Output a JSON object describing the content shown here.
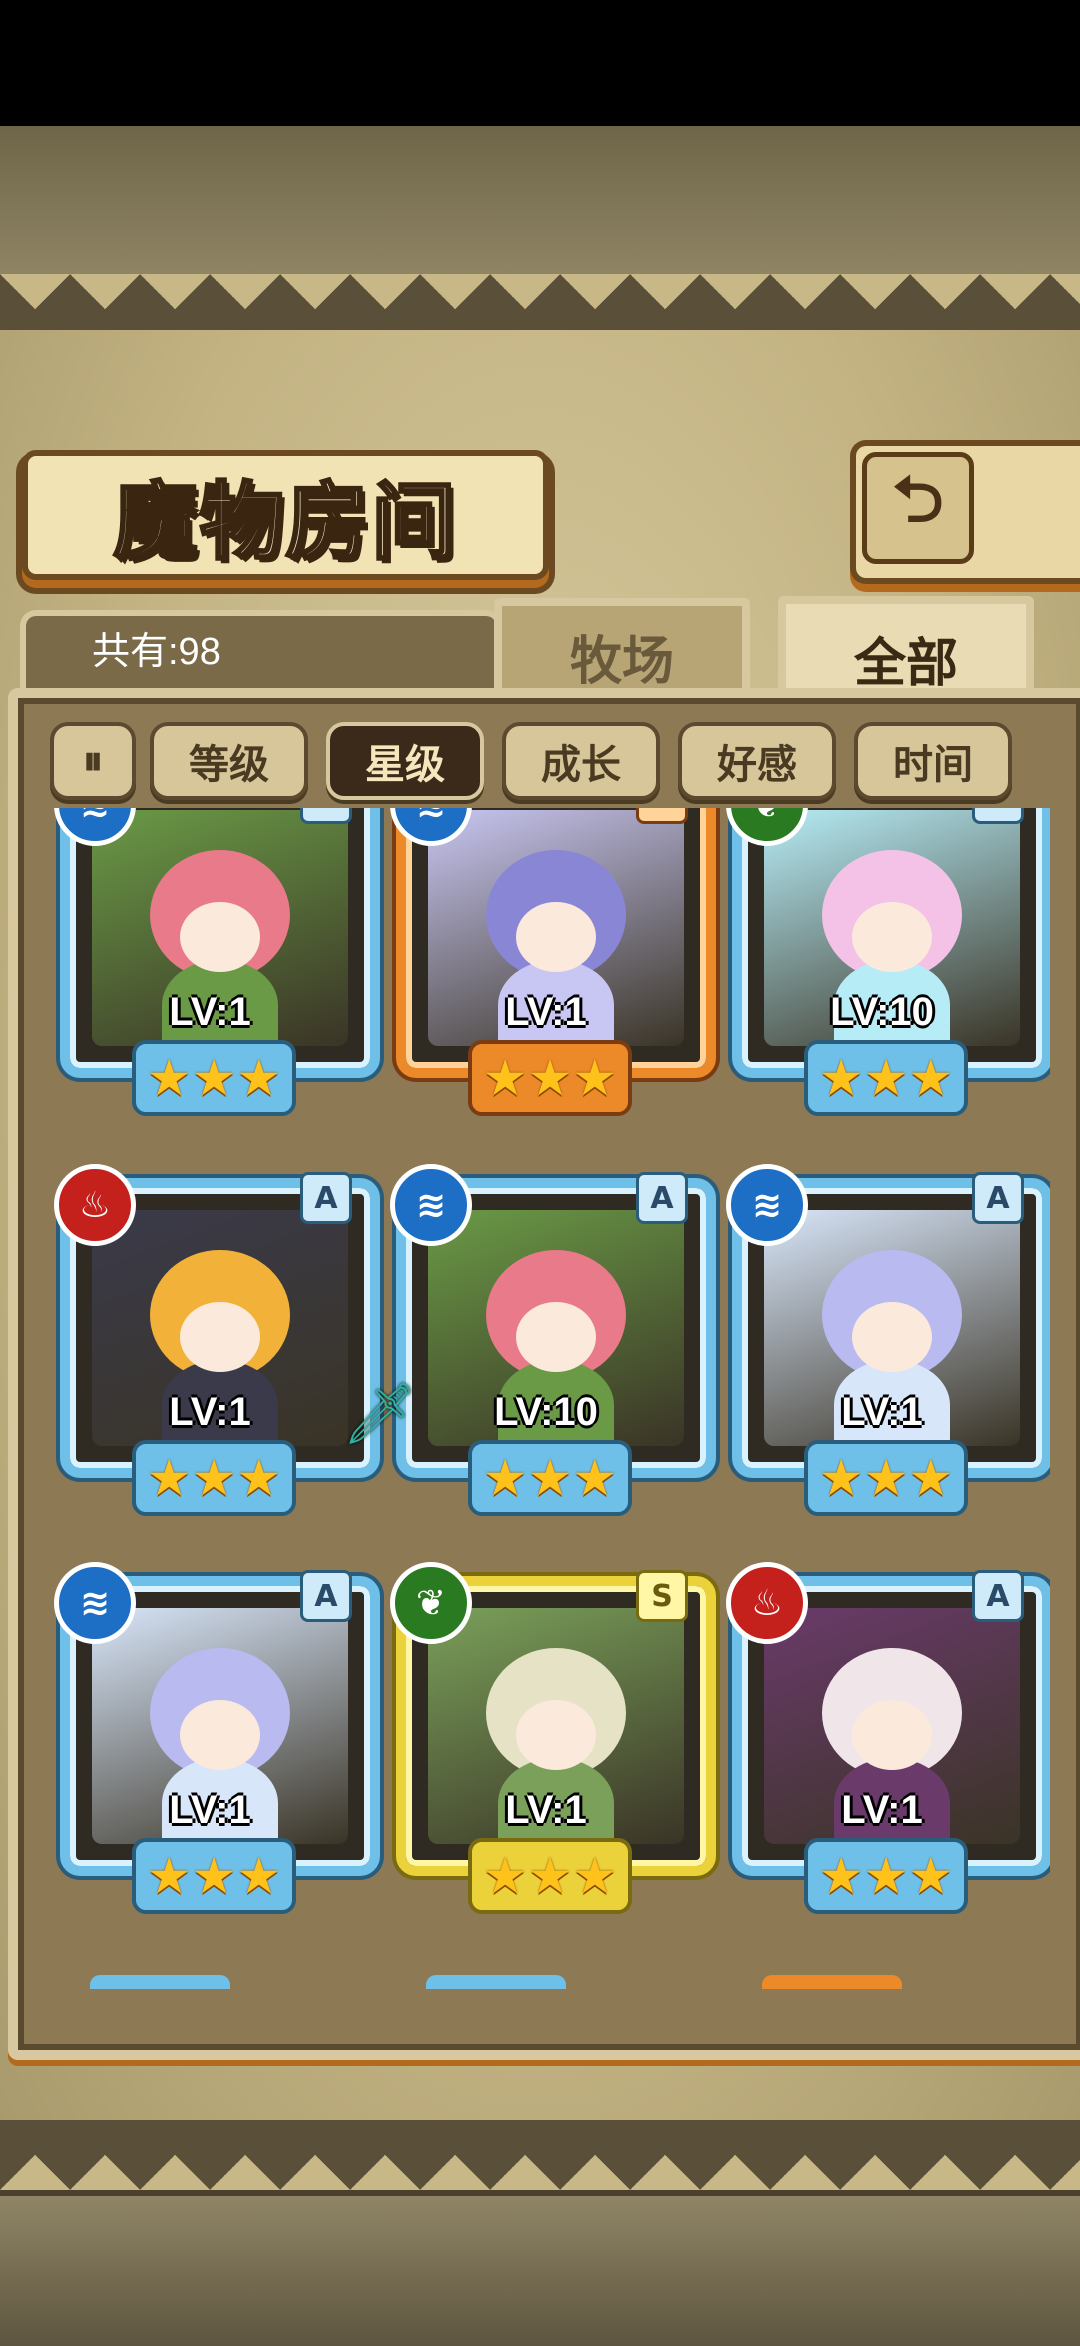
{
  "header": {
    "title": "魔物房间",
    "back_icon": "back-arrow-icon"
  },
  "info": {
    "count_text": "共有:98"
  },
  "tabs": [
    {
      "label": "牧场",
      "active": false
    },
    {
      "label": "全部",
      "active": true
    }
  ],
  "sort": {
    "pause_symbol": "⏸",
    "buttons": [
      {
        "label": "等级",
        "active": false
      },
      {
        "label": "星级",
        "active": true
      },
      {
        "label": "成长",
        "active": false
      },
      {
        "label": "好感",
        "active": false
      },
      {
        "label": "时间",
        "active": false
      }
    ]
  },
  "elements": {
    "water": {
      "icon": "water-icon",
      "glyph": "≋",
      "color": "#1c6fc4"
    },
    "fire": {
      "icon": "fire-icon",
      "glyph": "♨",
      "color": "#c4201c"
    },
    "wood": {
      "icon": "leaf-icon",
      "glyph": "❦",
      "color": "#2a7a22"
    }
  },
  "monsters": [
    {
      "element": "water",
      "rank": "A",
      "level": "LV:1",
      "stars": 3,
      "palette": [
        "#e87a8a",
        "#6a9a46"
      ],
      "equipped": false
    },
    {
      "element": "water",
      "rank": "B",
      "level": "LV:1",
      "stars": 3,
      "palette": [
        "#8a86d6",
        "#c8c6f2"
      ],
      "equipped": false
    },
    {
      "element": "wood",
      "rank": "A",
      "level": "LV:10",
      "stars": 3,
      "palette": [
        "#f4c2e6",
        "#b6ecf6"
      ],
      "equipped": false
    },
    {
      "element": "fire",
      "rank": "A",
      "level": "LV:1",
      "stars": 3,
      "palette": [
        "#f2b23a",
        "#3a3a4a"
      ],
      "equipped": false
    },
    {
      "element": "water",
      "rank": "A",
      "level": "LV:10",
      "stars": 3,
      "palette": [
        "#e87a8a",
        "#6a9a46"
      ],
      "equipped": true
    },
    {
      "element": "water",
      "rank": "A",
      "level": "LV:1",
      "stars": 3,
      "palette": [
        "#b8baf0",
        "#d8e6fa"
      ],
      "equipped": false
    },
    {
      "element": "water",
      "rank": "A",
      "level": "LV:1",
      "stars": 3,
      "palette": [
        "#b8baf0",
        "#d8e6fa"
      ],
      "equipped": false
    },
    {
      "element": "wood",
      "rank": "S",
      "level": "LV:1",
      "stars": 3,
      "palette": [
        "#e6e2c6",
        "#7aa05a"
      ],
      "equipped": false
    },
    {
      "element": "fire",
      "rank": "A",
      "level": "LV:1",
      "stars": 3,
      "palette": [
        "#f0e6ea",
        "#6a3a6a"
      ],
      "equipped": false
    }
  ],
  "colors": {
    "frame_blue": "#6fc0e8",
    "frame_orange": "#ec8a2a",
    "frame_gold": "#ecd23a",
    "star": "#ffc21a"
  }
}
